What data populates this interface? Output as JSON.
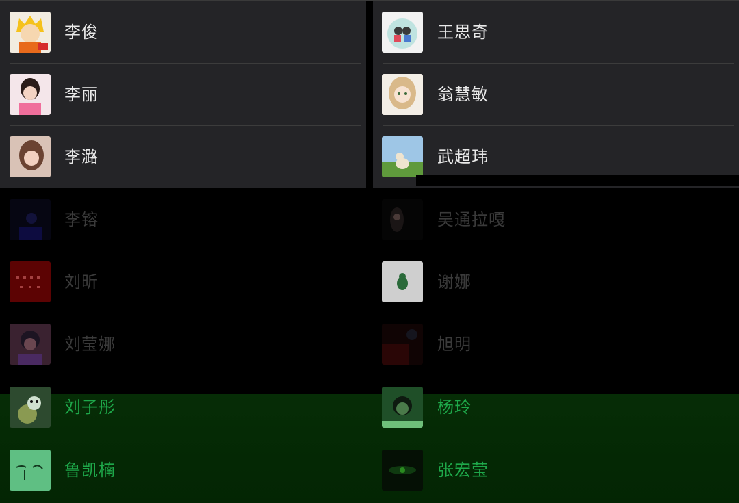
{
  "left_column": [
    {
      "name": "李俊",
      "avatar": "cartoon-boy-avatar"
    },
    {
      "name": "李丽",
      "avatar": "girl-photo-avatar"
    },
    {
      "name": "李潞",
      "avatar": "woman-photo-avatar"
    },
    {
      "name": "李镕",
      "avatar": "dark-blue-photo-avatar"
    },
    {
      "name": "刘昕",
      "avatar": "red-pattern-avatar"
    },
    {
      "name": "刘莹娜",
      "avatar": "anime-character-avatar"
    },
    {
      "name": "刘子彤",
      "avatar": "panda-bear-avatar"
    },
    {
      "name": "鲁凯楠",
      "avatar": "green-sketch-avatar"
    }
  ],
  "right_column": [
    {
      "name": "王思奇",
      "avatar": "couple-cartoon-avatar"
    },
    {
      "name": "翁慧敏",
      "avatar": "anime-girl-avatar"
    },
    {
      "name": "武超玮",
      "avatar": "dog-on-grass-avatar"
    },
    {
      "name": "吴通拉嘎",
      "avatar": "dark-portrait-avatar"
    },
    {
      "name": "谢娜",
      "avatar": "green-cartoon-avatar"
    },
    {
      "name": "旭明",
      "avatar": "dark-red-photo-avatar"
    },
    {
      "name": "杨玲",
      "avatar": "green-photo-avatar"
    },
    {
      "name": "张宏莹",
      "avatar": "dark-landscape-avatar"
    }
  ],
  "colors": {
    "row_background": "#242427",
    "name_text": "#e9e9e9",
    "green_tint": "#1ea84a",
    "divider": "#3c3c3c"
  }
}
